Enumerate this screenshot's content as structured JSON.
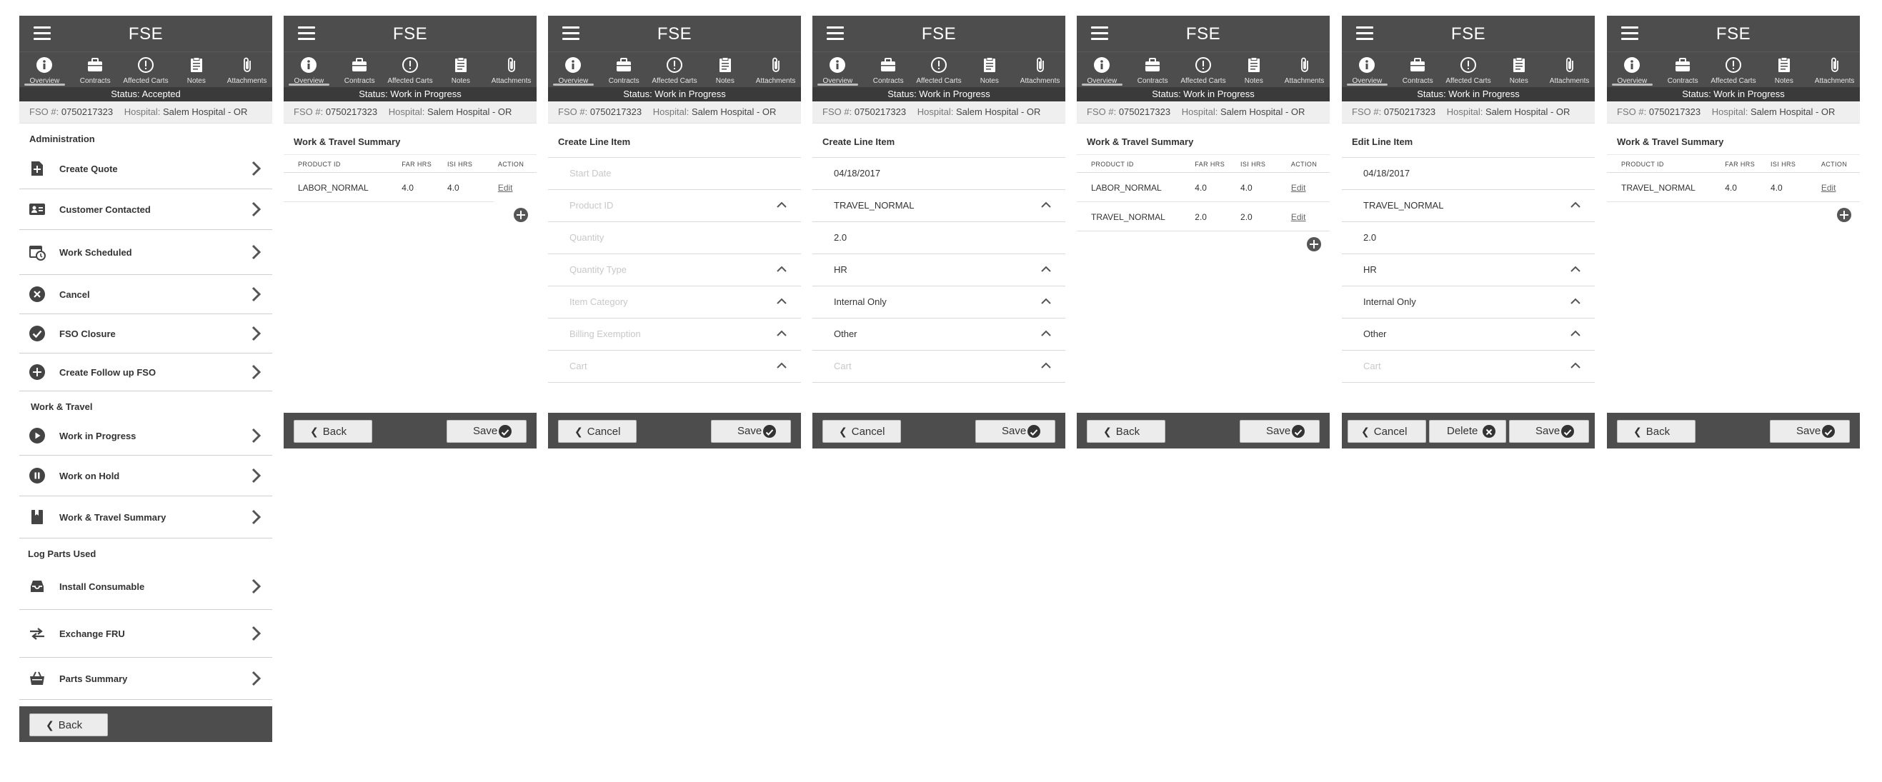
{
  "app": {
    "title": "FSE"
  },
  "tabs": [
    "Overview",
    "Contracts",
    "Affected Carts",
    "Notes",
    "Attachments"
  ],
  "status": {
    "accepted": "Status: Accepted",
    "in_progress": "Status: Work in Progress"
  },
  "fso": {
    "label": "FSO #:",
    "number": "0750217323",
    "hospital_label": "Hospital:",
    "hospital": "Salem Hospital - OR"
  },
  "panel1": {
    "admin_title": "Administration",
    "admin_items": [
      "Create Quote",
      "Customer Contacted",
      "Work Scheduled",
      "Cancel",
      "FSO Closure",
      "Create Follow up FSO"
    ],
    "wt_title": "Work & Travel",
    "wt_items": [
      "Work in Progress",
      "Work on Hold",
      "Work & Travel Summary"
    ],
    "parts_title": "Log Parts Used",
    "parts_items": [
      "Install Consumable",
      "Exchange FRU",
      "Parts Summary"
    ],
    "back": "Back"
  },
  "wt_summary": {
    "title": "Work & Travel Summary",
    "headers": [
      "PRODUCT ID",
      "FAR HRS",
      "ISI HRS",
      "ACTION"
    ],
    "edit": "Edit",
    "p2_rows": [
      [
        "LABOR_NORMAL",
        "4.0",
        "4.0"
      ]
    ],
    "p5_rows": [
      [
        "LABOR_NORMAL",
        "4.0",
        "4.0"
      ],
      [
        "TRAVEL_NORMAL",
        "2.0",
        "2.0"
      ]
    ],
    "p7_rows": [
      [
        "TRAVEL_NORMAL",
        "4.0",
        "4.0"
      ]
    ]
  },
  "create_form": {
    "title": "Create Line Item",
    "placeholders": [
      "Start Date",
      "Product ID",
      "Quantity",
      "Quantity Type",
      "Item Category",
      "Billing Exemption",
      "Cart"
    ],
    "values": [
      "04/18/2017",
      "TRAVEL_NORMAL",
      "2.0",
      "HR",
      "Internal Only",
      "Other"
    ]
  },
  "edit_form": {
    "title": "Edit Line Item"
  },
  "buttons": {
    "back": "Back",
    "save": "Save",
    "cancel": "Cancel",
    "delete": "Delete"
  }
}
